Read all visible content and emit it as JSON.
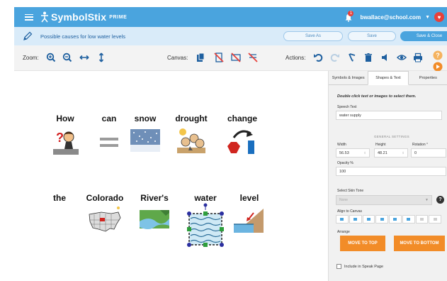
{
  "topbar": {
    "brand": "SymbolStix",
    "brand_suffix": "PRIME",
    "notifications": "1",
    "user_email": "bwallace@school.com"
  },
  "titlebar": {
    "document_title": "Possible causes for low water levels",
    "save_as": "Save As",
    "save": "Save",
    "save_close": "Save & Close"
  },
  "toolbar": {
    "zoom_label": "Zoom:",
    "canvas_label": "Canvas:",
    "actions_label": "Actions:"
  },
  "canvas": {
    "row1": [
      "How",
      "can",
      "snow",
      "drought",
      "change"
    ],
    "row2": [
      "the",
      "Colorado",
      "River's",
      "water",
      "level"
    ]
  },
  "panel": {
    "tabs": [
      "Symbols & Images",
      "Shapes & Text",
      "Properties"
    ],
    "hint": "Double click text or images to select them.",
    "speech_text_label": "Speech Text",
    "speech_text_value": "water supply",
    "general_settings": "GENERAL SETTINGS",
    "width_label": "Width",
    "width_value": "56.53",
    "height_label": "Height",
    "height_value": "48.21",
    "rotation_label": "Rotation °",
    "rotation_value": "0",
    "opacity_label": "Opacity %",
    "opacity_value": "100",
    "skin_tone_label": "Select Skin Tone",
    "skin_tone_value": "None",
    "align_label": "Align to Canvas",
    "arrange_label": "Arrange",
    "move_top": "MOVE TO TOP",
    "move_bottom": "MOVE TO BOTTOM",
    "include_speak_page": "Include in Speak Page"
  },
  "colors": {
    "brand_blue": "#4aa4de",
    "title_bg": "#d9ebf9",
    "orange": "#f28c28",
    "red": "#e8403a"
  }
}
